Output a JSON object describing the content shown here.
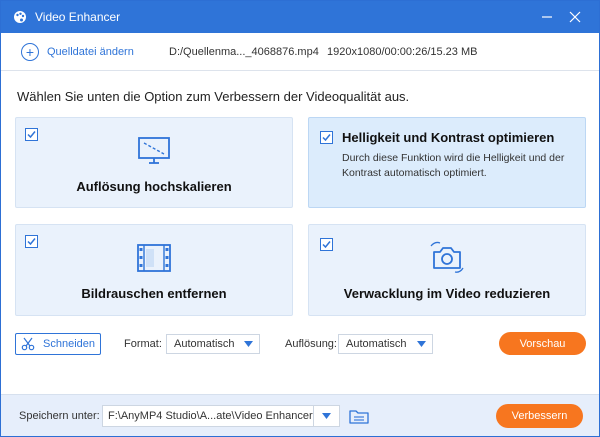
{
  "window": {
    "title": "Video Enhancer",
    "accent_color": "#2f74d8",
    "action_color": "#f7761f"
  },
  "source": {
    "add_label": "Quelldatei ändern",
    "file_path": "D:/Quellenma..._4068876.mp4",
    "file_meta": "1920x1080/00:00:26/15.23 MB"
  },
  "instruction": "Wählen Sie unten die Option zum Verbessern der Videoqualität aus.",
  "options": [
    {
      "label": "Auflösung hochskalieren",
      "checked": true,
      "icon": "monitor-upscale-icon"
    },
    {
      "label": "Helligkeit und Kontrast optimieren",
      "description": "Durch diese Funktion wird die Helligkeit und der Kontrast automatisch optimiert.",
      "checked": true,
      "icon": ""
    },
    {
      "label": "Bildrauschen entfernen",
      "checked": true,
      "icon": "film-strip-icon"
    },
    {
      "label": "Verwacklung im Video reduzieren",
      "checked": true,
      "icon": "camera-shake-icon"
    }
  ],
  "controls": {
    "cut_label": "Schneiden",
    "format_label": "Format:",
    "format_value": "Automatisch",
    "resolution_label": "Auflösung:",
    "resolution_value": "Automatisch",
    "preview_label": "Vorschau"
  },
  "footer": {
    "save_label": "Speichern unter:",
    "save_path": "F:\\AnyMP4 Studio\\A...ate\\Video Enhancer",
    "enhance_label": "Verbessern"
  }
}
